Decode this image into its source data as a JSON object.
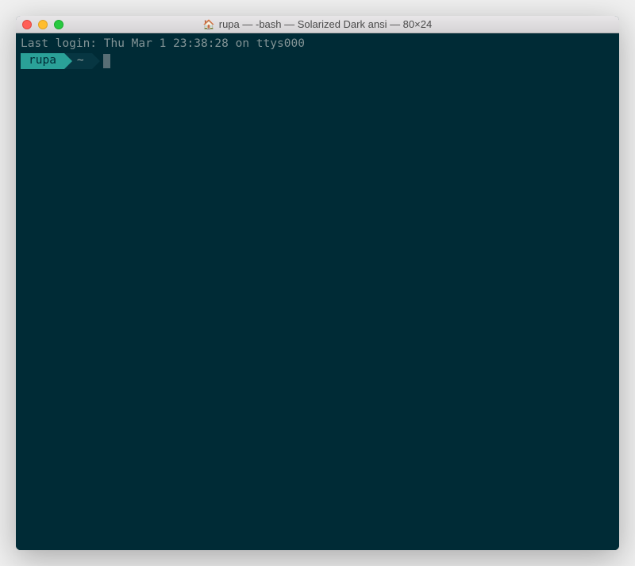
{
  "titlebar": {
    "icon": "🏠",
    "title": "rupa — -bash — Solarized Dark ansi — 80×24"
  },
  "terminal": {
    "last_login": "Last login: Thu Mar  1 23:38:28 on ttys000",
    "prompt": {
      "user": "rupa",
      "path": "~"
    }
  }
}
